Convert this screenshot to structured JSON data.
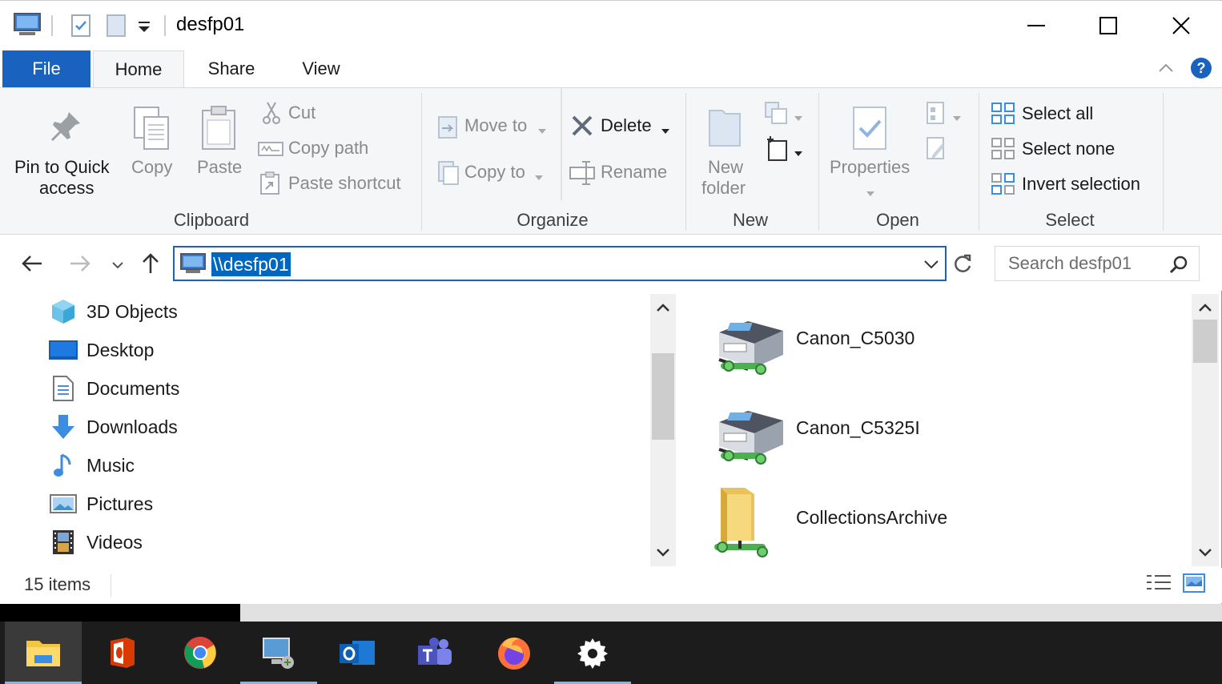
{
  "window": {
    "title": "desfp01",
    "minimize_icon": "minimize-icon",
    "maximize_icon": "maximize-icon",
    "close_icon": "close-icon"
  },
  "tabs": [
    {
      "label": "File"
    },
    {
      "label": "Home"
    },
    {
      "label": "Share"
    },
    {
      "label": "View"
    }
  ],
  "ribbon": {
    "clipboard": {
      "pin_label_1": "Pin to Quick",
      "pin_label_2": "access",
      "copy": "Copy",
      "paste": "Paste",
      "cut": "Cut",
      "copy_path": "Copy path",
      "paste_shortcut": "Paste shortcut",
      "group": "Clipboard"
    },
    "organize": {
      "move_to": "Move to",
      "copy_to": "Copy to",
      "delete": "Delete",
      "rename": "Rename",
      "group": "Organize"
    },
    "new": {
      "new_folder_1": "New",
      "new_folder_2": "folder",
      "group": "New"
    },
    "open": {
      "properties": "Properties",
      "group": "Open"
    },
    "select": {
      "select_all": "Select all",
      "select_none": "Select none",
      "invert_selection": "Invert selection",
      "group": "Select"
    }
  },
  "nav": {
    "address": "\\\\desfp01",
    "search_placeholder": "Search desfp01"
  },
  "sidebar": {
    "items": [
      {
        "label": "3D Objects",
        "icon": "cube-icon"
      },
      {
        "label": "Desktop",
        "icon": "desktop-icon"
      },
      {
        "label": "Documents",
        "icon": "document-icon"
      },
      {
        "label": "Downloads",
        "icon": "download-arrow-icon"
      },
      {
        "label": "Music",
        "icon": "music-note-icon"
      },
      {
        "label": "Pictures",
        "icon": "picture-icon"
      },
      {
        "label": "Videos",
        "icon": "film-icon"
      }
    ]
  },
  "content": {
    "items": [
      {
        "name": "Canon_C5030",
        "icon": "network-printer-icon"
      },
      {
        "name": "Canon_C5325I",
        "icon": "network-printer-icon"
      },
      {
        "name": "CollectionsArchive",
        "icon": "shared-folder-icon"
      }
    ]
  },
  "status": {
    "count": "15 items"
  },
  "taskbar": {
    "apps": [
      {
        "name": "file-explorer-icon"
      },
      {
        "name": "office-icon"
      },
      {
        "name": "chrome-icon"
      },
      {
        "name": "remote-desktop-icon"
      },
      {
        "name": "outlook-icon"
      },
      {
        "name": "teams-icon"
      },
      {
        "name": "firefox-icon"
      },
      {
        "name": "settings-icon"
      }
    ]
  },
  "colors": {
    "accent": "#1a62c0",
    "selection": "#0067c0",
    "taskbar": "#1c1c1c"
  }
}
